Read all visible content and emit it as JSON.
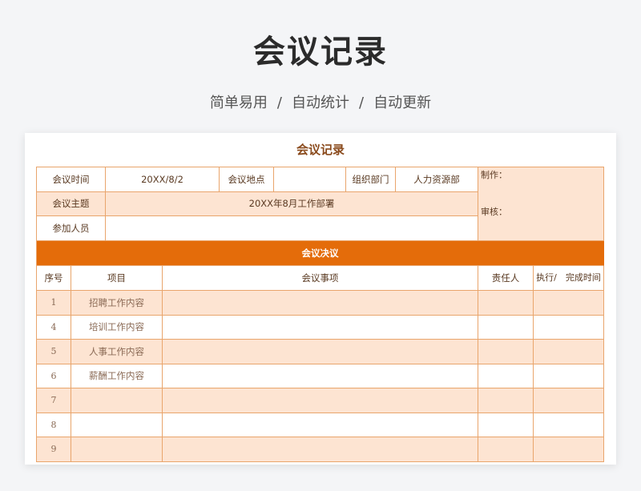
{
  "page": {
    "title": "会议记录",
    "subtitle_parts": [
      "简单易用",
      "自动统计",
      "自动更新"
    ],
    "separator": "/"
  },
  "document": {
    "title": "会议记录",
    "header": {
      "time_label": "会议时间",
      "time_value": "20XX/8/2",
      "location_label": "会议地点",
      "location_value": "",
      "org_label": "组织部门",
      "org_value": "人力资源部",
      "topic_label": "会议主题",
      "topic_value": "20XX年8月工作部署",
      "attendees_label": "参加人员",
      "attendees_value": "",
      "maker_label": "制作：",
      "reviewer_label": "审核："
    },
    "section_title": "会议决议",
    "columns": [
      "序号",
      "项目",
      "会议事项",
      "责任人",
      "执行/　完成时间"
    ],
    "rows": [
      {
        "seq": "1",
        "item": "招聘工作内容"
      },
      {
        "seq": "4",
        "item": "培训工作内容"
      },
      {
        "seq": "5",
        "item": "人事工作内容"
      },
      {
        "seq": "6",
        "item": "薪酬工作内容"
      },
      {
        "seq": "7",
        "item": ""
      },
      {
        "seq": "8",
        "item": ""
      },
      {
        "seq": "9",
        "item": ""
      }
    ]
  },
  "colors": {
    "accent": "#e46c0a",
    "row_fill": "#fde4d2",
    "border": "#e9a56c",
    "title_text": "#8a4a1c"
  }
}
